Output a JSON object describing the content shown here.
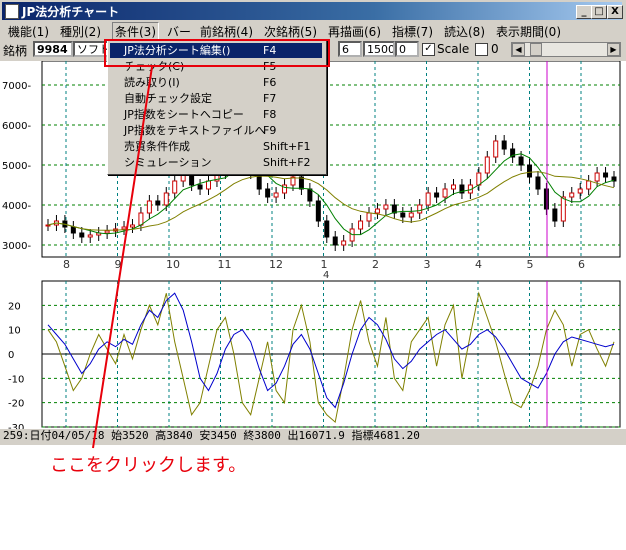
{
  "window": {
    "title": "JP法分析チャート",
    "minimize": "_",
    "maximize": "□",
    "close": "X"
  },
  "menu": [
    "機能(1)",
    "種別(2)",
    "条件(3)",
    "バー",
    "前銘柄(4)",
    "次銘柄(5)",
    "再描画(6)",
    "指標(7)",
    "読込(8)",
    "表示期間(0)"
  ],
  "toolbar": {
    "label": "銘柄",
    "code": "9984",
    "name": "ソフトバ",
    "period": "6",
    "value1": "1500",
    "value2": "0",
    "scale_label": "Scale",
    "scale_checked": true,
    "zero_label": "0",
    "zero_checked": false
  },
  "dropdown": [
    {
      "label": "JP法分析シート編集()",
      "shortcut": "F4"
    },
    {
      "label": "チェック(C)",
      "shortcut": "F5"
    },
    {
      "label": "読み取り(I)",
      "shortcut": "F6"
    },
    {
      "label": "自動チェック設定",
      "shortcut": "F7"
    },
    {
      "label": "JP指数をシートへコピー",
      "shortcut": "F8"
    },
    {
      "label": "JP指数をテキストファイルへ",
      "shortcut": "F9"
    },
    {
      "label": "売買条件作成",
      "shortcut": "Shift+F1"
    },
    {
      "label": "シミュレーション",
      "shortcut": "Shift+F2"
    }
  ],
  "status": "259:日付04/05/18 始3520 高3840 安3450 終3800 出16071.9 指標4681.20",
  "annotation": "ここをクリックします。",
  "colors": {
    "accent": "#e8000b",
    "highlight": "#0a246a",
    "cursor": "#cc00cc",
    "ma_short": "#008000",
    "ma_long": "#808000",
    "osc_blue": "#0000cc",
    "osc_olive": "#808000"
  },
  "chart_data": [
    {
      "type": "candlestick",
      "y_ticks": [
        "7000",
        "6000",
        "5000",
        "4000",
        "3000"
      ],
      "ylim": [
        2700,
        7600
      ],
      "x_tick_labels": [
        "8",
        "9",
        "10",
        "11",
        "12",
        "1",
        "2",
        "3",
        "4",
        "5",
        "6"
      ],
      "year_label": "4",
      "closes": [
        3500,
        3600,
        3450,
        3300,
        3200,
        3250,
        3300,
        3350,
        3400,
        3450,
        3500,
        3800,
        4100,
        4000,
        4300,
        4600,
        4900,
        4500,
        4400,
        4600,
        4800,
        5100,
        5300,
        5000,
        4800,
        4400,
        4200,
        4300,
        4500,
        4700,
        4400,
        4100,
        3600,
        3200,
        3000,
        3100,
        3400,
        3600,
        3800,
        3900,
        4000,
        3800,
        3700,
        3800,
        4000,
        4300,
        4200,
        4400,
        4500,
        4300,
        4500,
        4800,
        5200,
        5600,
        5400,
        5200,
        5000,
        4700,
        4400,
        3900,
        3600,
        4200,
        4300,
        4400,
        4600,
        4800,
        4700,
        4600
      ]
    },
    {
      "type": "line",
      "y_ticks": [
        "20",
        "10",
        "0",
        "-10",
        "-20",
        "-30"
      ],
      "ylim": [
        -30,
        30
      ],
      "series": [
        {
          "values": [
            12,
            8,
            4,
            -2,
            -8,
            -4,
            2,
            5,
            3,
            6,
            4,
            12,
            18,
            15,
            22,
            25,
            18,
            5,
            -10,
            -15,
            -8,
            2,
            8,
            10,
            5,
            -6,
            -15,
            -12,
            -5,
            4,
            8,
            2,
            -8,
            -18,
            -22,
            -12,
            0,
            10,
            15,
            12,
            6,
            -2,
            -6,
            -3,
            2,
            5,
            8,
            10,
            6,
            2,
            4,
            8,
            10,
            7,
            2,
            -4,
            -10,
            -12,
            -14,
            -8,
            0,
            5,
            7,
            6,
            5,
            4,
            3,
            4
          ]
        },
        {
          "values": [
            10,
            5,
            -5,
            -15,
            -10,
            0,
            8,
            2,
            -4,
            8,
            -2,
            10,
            20,
            12,
            25,
            5,
            -10,
            -25,
            -20,
            -5,
            10,
            15,
            0,
            -20,
            -25,
            -10,
            5,
            -15,
            -20,
            10,
            20,
            5,
            -20,
            -25,
            -28,
            -10,
            10,
            22,
            5,
            -5,
            15,
            -10,
            -15,
            5,
            10,
            15,
            -5,
            12,
            20,
            -10,
            8,
            25,
            15,
            5,
            -8,
            -20,
            -22,
            -15,
            -5,
            10,
            18,
            12,
            -5,
            8,
            10,
            2,
            -5,
            5
          ]
        }
      ]
    }
  ]
}
